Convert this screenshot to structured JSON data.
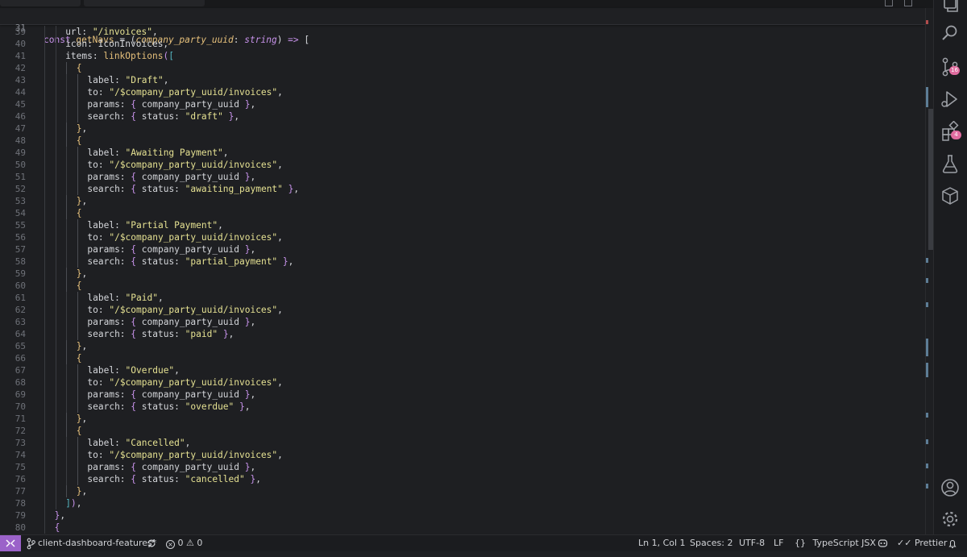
{
  "editor": {
    "sticky": {
      "num": "31",
      "parts": [
        {
          "t": "const ",
          "c": "kw"
        },
        {
          "t": "getNavs",
          "c": "fn"
        },
        {
          "t": " = (",
          "c": "prop"
        },
        {
          "t": "company_party_uuid",
          "c": "param"
        },
        {
          "t": ": ",
          "c": "prop"
        },
        {
          "t": "string",
          "c": "type"
        },
        {
          "t": ") ",
          "c": "prop"
        },
        {
          "t": "=>",
          "c": "op"
        },
        {
          "t": " [",
          "c": "prop"
        }
      ]
    },
    "lines": [
      {
        "num": "39",
        "indent": 2,
        "parts": [
          {
            "t": "url: ",
            "c": "prop"
          },
          {
            "t": "\"/invoices\"",
            "c": "str"
          },
          {
            "t": ",",
            "c": "prop"
          }
        ]
      },
      {
        "num": "40",
        "indent": 2,
        "parts": [
          {
            "t": "icon: IconInvoices,",
            "c": "prop"
          }
        ]
      },
      {
        "num": "41",
        "indent": 2,
        "parts": [
          {
            "t": "items: ",
            "c": "prop"
          },
          {
            "t": "linkOptions",
            "c": "fn"
          },
          {
            "t": "(",
            "c": "br2"
          },
          {
            "t": "[",
            "c": "br3"
          }
        ]
      },
      {
        "num": "42",
        "indent": 3,
        "parts": [
          {
            "t": "{",
            "c": "br1"
          }
        ]
      },
      {
        "num": "43",
        "indent": 4,
        "parts": [
          {
            "t": "label: ",
            "c": "prop"
          },
          {
            "t": "\"Draft\"",
            "c": "str"
          },
          {
            "t": ",",
            "c": "prop"
          }
        ]
      },
      {
        "num": "44",
        "indent": 4,
        "parts": [
          {
            "t": "to: ",
            "c": "prop"
          },
          {
            "t": "\"/$company_party_uuid/invoices\"",
            "c": "str"
          },
          {
            "t": ",",
            "c": "prop"
          }
        ]
      },
      {
        "num": "45",
        "indent": 4,
        "parts": [
          {
            "t": "params: ",
            "c": "prop"
          },
          {
            "t": "{",
            "c": "br2"
          },
          {
            "t": " company_party_uuid ",
            "c": "prop"
          },
          {
            "t": "}",
            "c": "br2"
          },
          {
            "t": ",",
            "c": "prop"
          }
        ]
      },
      {
        "num": "46",
        "indent": 4,
        "parts": [
          {
            "t": "search: ",
            "c": "prop"
          },
          {
            "t": "{",
            "c": "br2"
          },
          {
            "t": " status: ",
            "c": "prop"
          },
          {
            "t": "\"draft\"",
            "c": "str"
          },
          {
            "t": " ",
            "c": "prop"
          },
          {
            "t": "}",
            "c": "br2"
          },
          {
            "t": ",",
            "c": "prop"
          }
        ]
      },
      {
        "num": "47",
        "indent": 3,
        "parts": [
          {
            "t": "}",
            "c": "br1"
          },
          {
            "t": ",",
            "c": "prop"
          }
        ]
      },
      {
        "num": "48",
        "indent": 3,
        "parts": [
          {
            "t": "{",
            "c": "br1"
          }
        ]
      },
      {
        "num": "49",
        "indent": 4,
        "parts": [
          {
            "t": "label: ",
            "c": "prop"
          },
          {
            "t": "\"Awaiting Payment\"",
            "c": "str"
          },
          {
            "t": ",",
            "c": "prop"
          }
        ]
      },
      {
        "num": "50",
        "indent": 4,
        "parts": [
          {
            "t": "to: ",
            "c": "prop"
          },
          {
            "t": "\"/$company_party_uuid/invoices\"",
            "c": "str"
          },
          {
            "t": ",",
            "c": "prop"
          }
        ]
      },
      {
        "num": "51",
        "indent": 4,
        "parts": [
          {
            "t": "params: ",
            "c": "prop"
          },
          {
            "t": "{",
            "c": "br2"
          },
          {
            "t": " company_party_uuid ",
            "c": "prop"
          },
          {
            "t": "}",
            "c": "br2"
          },
          {
            "t": ",",
            "c": "prop"
          }
        ]
      },
      {
        "num": "52",
        "indent": 4,
        "parts": [
          {
            "t": "search: ",
            "c": "prop"
          },
          {
            "t": "{",
            "c": "br2"
          },
          {
            "t": " status: ",
            "c": "prop"
          },
          {
            "t": "\"awaiting_payment\"",
            "c": "str"
          },
          {
            "t": " ",
            "c": "prop"
          },
          {
            "t": "}",
            "c": "br2"
          },
          {
            "t": ",",
            "c": "prop"
          }
        ]
      },
      {
        "num": "53",
        "indent": 3,
        "parts": [
          {
            "t": "}",
            "c": "br1"
          },
          {
            "t": ",",
            "c": "prop"
          }
        ]
      },
      {
        "num": "54",
        "indent": 3,
        "parts": [
          {
            "t": "{",
            "c": "br1"
          }
        ]
      },
      {
        "num": "55",
        "indent": 4,
        "parts": [
          {
            "t": "label: ",
            "c": "prop"
          },
          {
            "t": "\"Partial Payment\"",
            "c": "str"
          },
          {
            "t": ",",
            "c": "prop"
          }
        ]
      },
      {
        "num": "56",
        "indent": 4,
        "parts": [
          {
            "t": "to: ",
            "c": "prop"
          },
          {
            "t": "\"/$company_party_uuid/invoices\"",
            "c": "str"
          },
          {
            "t": ",",
            "c": "prop"
          }
        ]
      },
      {
        "num": "57",
        "indent": 4,
        "parts": [
          {
            "t": "params: ",
            "c": "prop"
          },
          {
            "t": "{",
            "c": "br2"
          },
          {
            "t": " company_party_uuid ",
            "c": "prop"
          },
          {
            "t": "}",
            "c": "br2"
          },
          {
            "t": ",",
            "c": "prop"
          }
        ]
      },
      {
        "num": "58",
        "indent": 4,
        "parts": [
          {
            "t": "search: ",
            "c": "prop"
          },
          {
            "t": "{",
            "c": "br2"
          },
          {
            "t": " status: ",
            "c": "prop"
          },
          {
            "t": "\"partial_payment\"",
            "c": "str"
          },
          {
            "t": " ",
            "c": "prop"
          },
          {
            "t": "}",
            "c": "br2"
          },
          {
            "t": ",",
            "c": "prop"
          }
        ]
      },
      {
        "num": "59",
        "indent": 3,
        "parts": [
          {
            "t": "}",
            "c": "br1"
          },
          {
            "t": ",",
            "c": "prop"
          }
        ]
      },
      {
        "num": "60",
        "indent": 3,
        "parts": [
          {
            "t": "{",
            "c": "br1"
          }
        ]
      },
      {
        "num": "61",
        "indent": 4,
        "parts": [
          {
            "t": "label: ",
            "c": "prop"
          },
          {
            "t": "\"Paid\"",
            "c": "str"
          },
          {
            "t": ",",
            "c": "prop"
          }
        ]
      },
      {
        "num": "62",
        "indent": 4,
        "parts": [
          {
            "t": "to: ",
            "c": "prop"
          },
          {
            "t": "\"/$company_party_uuid/invoices\"",
            "c": "str"
          },
          {
            "t": ",",
            "c": "prop"
          }
        ]
      },
      {
        "num": "63",
        "indent": 4,
        "parts": [
          {
            "t": "params: ",
            "c": "prop"
          },
          {
            "t": "{",
            "c": "br2"
          },
          {
            "t": " company_party_uuid ",
            "c": "prop"
          },
          {
            "t": "}",
            "c": "br2"
          },
          {
            "t": ",",
            "c": "prop"
          }
        ]
      },
      {
        "num": "64",
        "indent": 4,
        "parts": [
          {
            "t": "search: ",
            "c": "prop"
          },
          {
            "t": "{",
            "c": "br2"
          },
          {
            "t": " status: ",
            "c": "prop"
          },
          {
            "t": "\"paid\"",
            "c": "str"
          },
          {
            "t": " ",
            "c": "prop"
          },
          {
            "t": "}",
            "c": "br2"
          },
          {
            "t": ",",
            "c": "prop"
          }
        ]
      },
      {
        "num": "65",
        "indent": 3,
        "parts": [
          {
            "t": "}",
            "c": "br1"
          },
          {
            "t": ",",
            "c": "prop"
          }
        ]
      },
      {
        "num": "66",
        "indent": 3,
        "parts": [
          {
            "t": "{",
            "c": "br1"
          }
        ]
      },
      {
        "num": "67",
        "indent": 4,
        "parts": [
          {
            "t": "label: ",
            "c": "prop"
          },
          {
            "t": "\"Overdue\"",
            "c": "str"
          },
          {
            "t": ",",
            "c": "prop"
          }
        ]
      },
      {
        "num": "68",
        "indent": 4,
        "parts": [
          {
            "t": "to: ",
            "c": "prop"
          },
          {
            "t": "\"/$company_party_uuid/invoices\"",
            "c": "str"
          },
          {
            "t": ",",
            "c": "prop"
          }
        ]
      },
      {
        "num": "69",
        "indent": 4,
        "parts": [
          {
            "t": "params: ",
            "c": "prop"
          },
          {
            "t": "{",
            "c": "br2"
          },
          {
            "t": " company_party_uuid ",
            "c": "prop"
          },
          {
            "t": "}",
            "c": "br2"
          },
          {
            "t": ",",
            "c": "prop"
          }
        ]
      },
      {
        "num": "70",
        "indent": 4,
        "parts": [
          {
            "t": "search: ",
            "c": "prop"
          },
          {
            "t": "{",
            "c": "br2"
          },
          {
            "t": " status: ",
            "c": "prop"
          },
          {
            "t": "\"overdue\"",
            "c": "str"
          },
          {
            "t": " ",
            "c": "prop"
          },
          {
            "t": "}",
            "c": "br2"
          },
          {
            "t": ",",
            "c": "prop"
          }
        ]
      },
      {
        "num": "71",
        "indent": 3,
        "parts": [
          {
            "t": "}",
            "c": "br1"
          },
          {
            "t": ",",
            "c": "prop"
          }
        ]
      },
      {
        "num": "72",
        "indent": 3,
        "parts": [
          {
            "t": "{",
            "c": "br1"
          }
        ]
      },
      {
        "num": "73",
        "indent": 4,
        "parts": [
          {
            "t": "label: ",
            "c": "prop"
          },
          {
            "t": "\"Cancelled\"",
            "c": "str"
          },
          {
            "t": ",",
            "c": "prop"
          }
        ]
      },
      {
        "num": "74",
        "indent": 4,
        "parts": [
          {
            "t": "to: ",
            "c": "prop"
          },
          {
            "t": "\"/$company_party_uuid/invoices\"",
            "c": "str"
          },
          {
            "t": ",",
            "c": "prop"
          }
        ]
      },
      {
        "num": "75",
        "indent": 4,
        "parts": [
          {
            "t": "params: ",
            "c": "prop"
          },
          {
            "t": "{",
            "c": "br2"
          },
          {
            "t": " company_party_uuid ",
            "c": "prop"
          },
          {
            "t": "}",
            "c": "br2"
          },
          {
            "t": ",",
            "c": "prop"
          }
        ]
      },
      {
        "num": "76",
        "indent": 4,
        "parts": [
          {
            "t": "search: ",
            "c": "prop"
          },
          {
            "t": "{",
            "c": "br2"
          },
          {
            "t": " status: ",
            "c": "prop"
          },
          {
            "t": "\"cancelled\"",
            "c": "str"
          },
          {
            "t": " ",
            "c": "prop"
          },
          {
            "t": "}",
            "c": "br2"
          },
          {
            "t": ",",
            "c": "prop"
          }
        ]
      },
      {
        "num": "77",
        "indent": 3,
        "parts": [
          {
            "t": "}",
            "c": "br1"
          },
          {
            "t": ",",
            "c": "prop"
          }
        ]
      },
      {
        "num": "78",
        "indent": 2,
        "parts": [
          {
            "t": "]",
            "c": "br3"
          },
          {
            "t": ")",
            "c": "br2"
          },
          {
            "t": ",",
            "c": "prop"
          }
        ]
      },
      {
        "num": "79",
        "indent": 1,
        "parts": [
          {
            "t": "}",
            "c": "br2"
          },
          {
            "t": ",",
            "c": "prop"
          }
        ]
      },
      {
        "num": "80",
        "indent": 1,
        "parts": [
          {
            "t": "{",
            "c": "br2"
          }
        ]
      }
    ]
  },
  "activity_bar": {
    "source_control_badge": "16",
    "extensions_badge": "4",
    "icons": [
      "copy-icon",
      "search-icon",
      "source-control-icon",
      "run-debug-icon",
      "extensions-icon",
      "testing-icon",
      "package-icon",
      "account-icon",
      "gear-icon"
    ]
  },
  "status_bar": {
    "branch": "client-dashboard-features*",
    "errors": "0",
    "warnings": "0",
    "cursor": "Ln 1, Col 1",
    "spaces": "Spaces: 2",
    "encoding": "UTF-8",
    "eol": "LF",
    "language_braces": "{}",
    "language": "TypeScript JSX",
    "prettier": "Prettier"
  },
  "colors": {
    "background": "#1e1f22",
    "keyword": "#c792ea",
    "string": "#e5e192",
    "function": "#e6c07b",
    "remote_indicator": "#9b62c9",
    "badge": "#e06c9f"
  }
}
